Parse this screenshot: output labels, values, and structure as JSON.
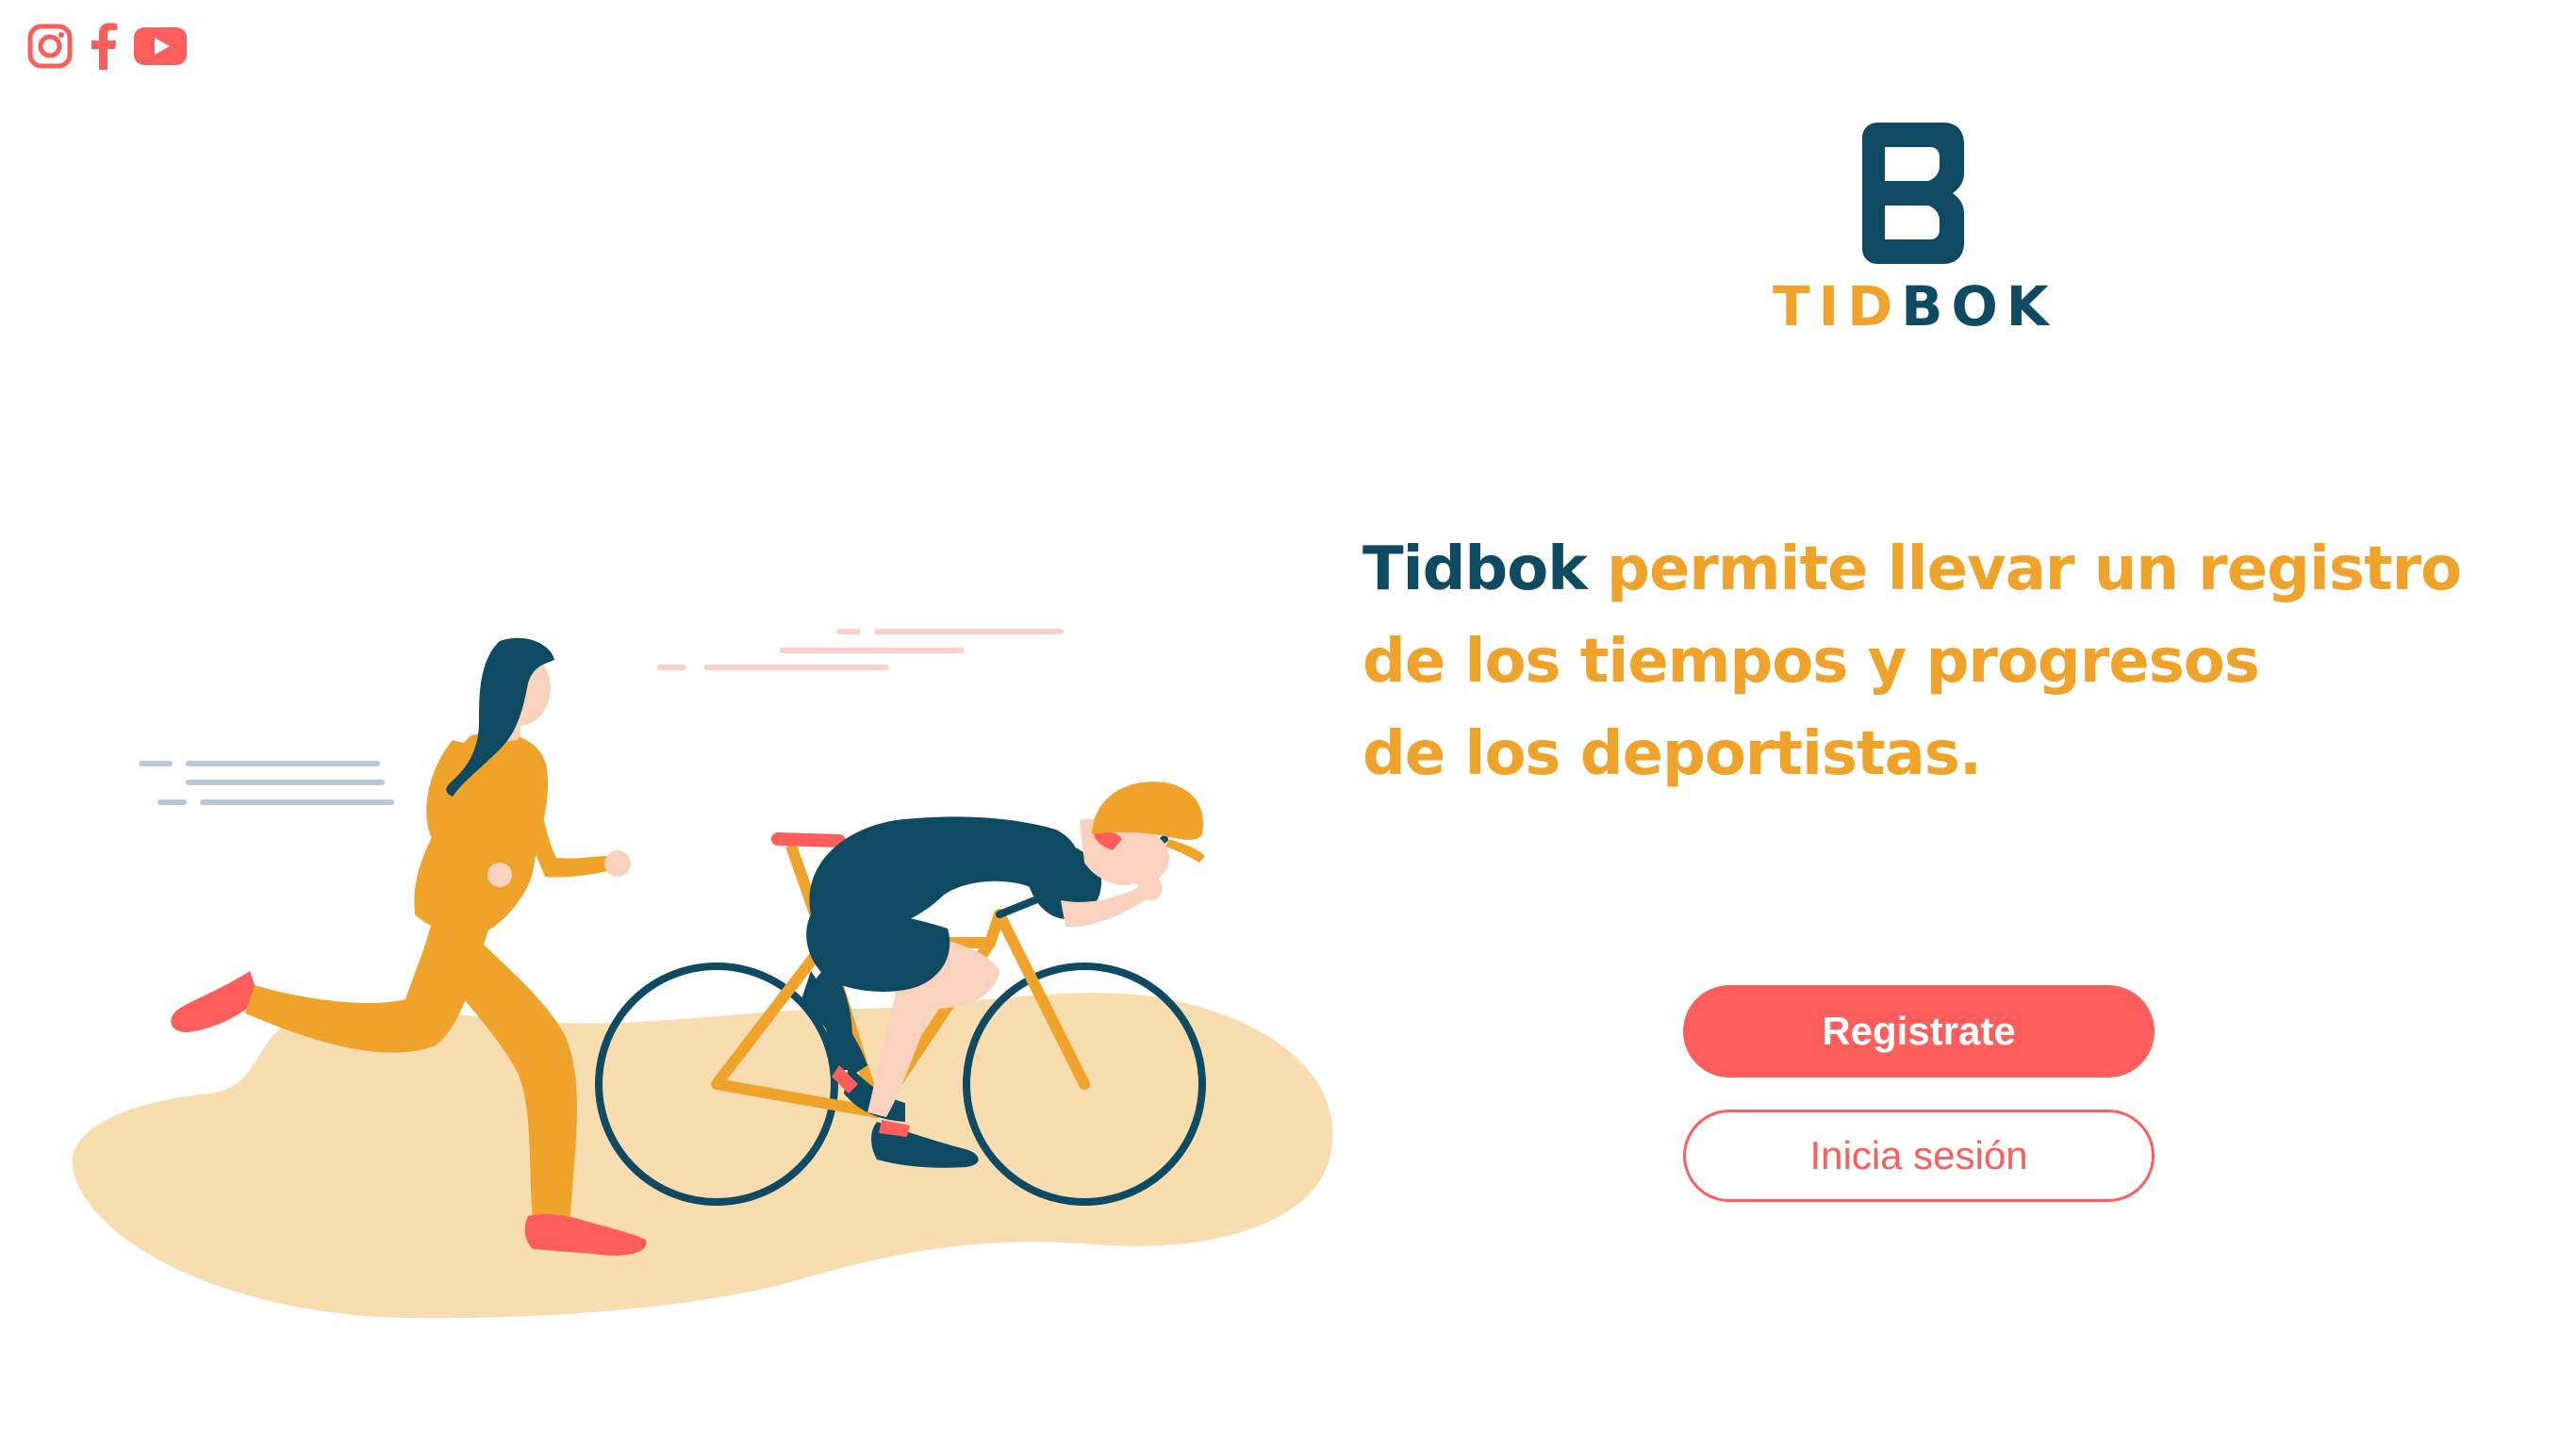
{
  "social": {
    "icons": [
      "instagram-icon",
      "facebook-icon",
      "youtube-icon"
    ],
    "color": "#fd5e5c"
  },
  "logo": {
    "word_part_1": "TID",
    "word_part_2": "BOK"
  },
  "headline": {
    "brand": "Tidbok",
    "line1_rest": " permite llevar un registro",
    "line2": "de los tiempos y progresos",
    "line3": "de los deportistas."
  },
  "actions": {
    "register_label": "Registrate",
    "login_label": "Inicia sesión"
  },
  "colors": {
    "navy": "#0f4a63",
    "orange": "#f0a32a",
    "coral": "#fd5e5c",
    "sand": "#f8ddb0",
    "skin": "#f9d2bd"
  }
}
